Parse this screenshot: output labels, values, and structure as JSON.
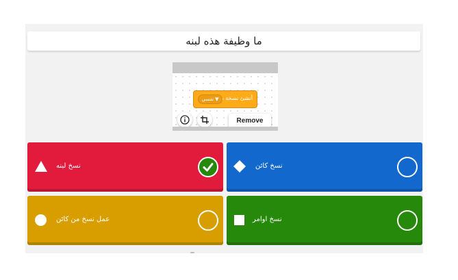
{
  "question": {
    "text": "ما وظيفة هذه لبنه"
  },
  "media": {
    "block_text": "أنشئ نسخة من",
    "block_dropdown": "نفسي",
    "remove_label": "Remove",
    "icons": [
      "info-icon",
      "crop-icon"
    ]
  },
  "answers": [
    {
      "text": "نسخ لبنه",
      "shape": "triangle",
      "color": "#e21b3c",
      "correct": true
    },
    {
      "text": "نسخ كائن",
      "shape": "diamond",
      "color": "#1368ce",
      "correct": false
    },
    {
      "text": "عمل نسخ من كائن",
      "shape": "circle",
      "color": "#d89e00",
      "correct": false
    },
    {
      "text": "نسخ اوامر",
      "shape": "square",
      "color": "#26890c",
      "correct": false
    }
  ]
}
